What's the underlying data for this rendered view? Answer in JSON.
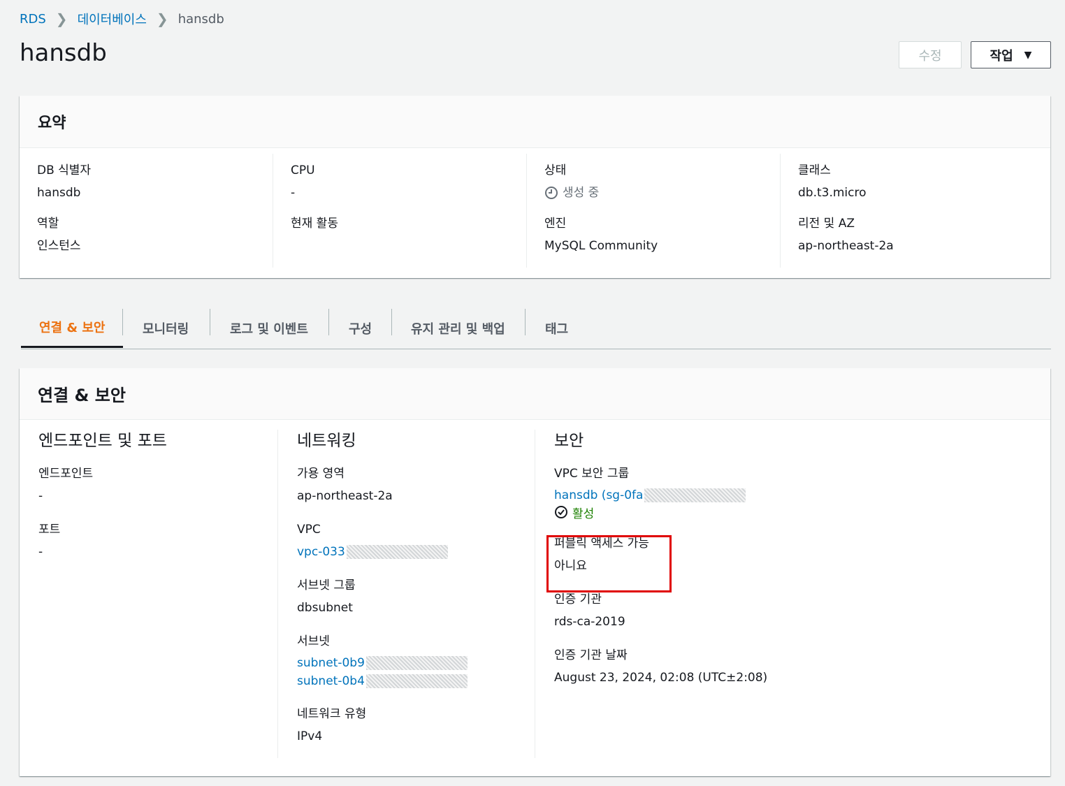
{
  "breadcrumb": {
    "items": [
      "RDS",
      "데이터베이스",
      "hansdb"
    ]
  },
  "page": {
    "title": "hansdb"
  },
  "actions": {
    "modify_label": "수정",
    "action_label": "작업"
  },
  "summary": {
    "title": "요약",
    "db_identifier": {
      "label": "DB 식별자",
      "value": "hansdb"
    },
    "role": {
      "label": "역할",
      "value": "인스턴스"
    },
    "cpu": {
      "label": "CPU",
      "value": "-"
    },
    "current_activity": {
      "label": "현재 활동",
      "value": ""
    },
    "status": {
      "label": "상태",
      "value": "생성 중"
    },
    "engine": {
      "label": "엔진",
      "value": "MySQL Community"
    },
    "class": {
      "label": "클래스",
      "value": "db.t3.micro"
    },
    "region_az": {
      "label": "리전 및 AZ",
      "value": "ap-northeast-2a"
    }
  },
  "tabs": [
    {
      "label": "연결 & 보안",
      "active": true
    },
    {
      "label": "모니터링"
    },
    {
      "label": "로그 및 이벤트"
    },
    {
      "label": "구성"
    },
    {
      "label": "유지 관리 및 백업"
    },
    {
      "label": "태그"
    }
  ],
  "connectivity": {
    "title": "연결 & 보안",
    "endpoint_section": {
      "title": "엔드포인트 및 포트",
      "endpoint": {
        "label": "엔드포인트",
        "value": "-"
      },
      "port": {
        "label": "포트",
        "value": "-"
      }
    },
    "networking": {
      "title": "네트워킹",
      "az": {
        "label": "가용 영역",
        "value": "ap-northeast-2a"
      },
      "vpc": {
        "label": "VPC",
        "value": "vpc-033"
      },
      "subnet_group": {
        "label": "서브넷 그룹",
        "value": "dbsubnet"
      },
      "subnets": {
        "label": "서브넷",
        "values": [
          "subnet-0b9",
          "subnet-0b4"
        ]
      },
      "network_type": {
        "label": "네트워크 유형",
        "value": "IPv4"
      }
    },
    "security": {
      "title": "보안",
      "vpc_sg": {
        "label": "VPC 보안 그룹",
        "value": "hansdb (sg-0fa",
        "status": "활성"
      },
      "public_access": {
        "label": "퍼블릭 액세스 가능",
        "value": "아니요"
      },
      "ca": {
        "label": "인증 기관",
        "value": "rds-ca-2019"
      },
      "ca_date": {
        "label": "인증 기관 날짜",
        "value": "August 23, 2024, 02:08 (UTC±2:08)"
      }
    }
  },
  "colors": {
    "link": "#0073bb",
    "active_tab": "#ec7211",
    "success": "#1d8102",
    "highlight": "#e00000"
  }
}
